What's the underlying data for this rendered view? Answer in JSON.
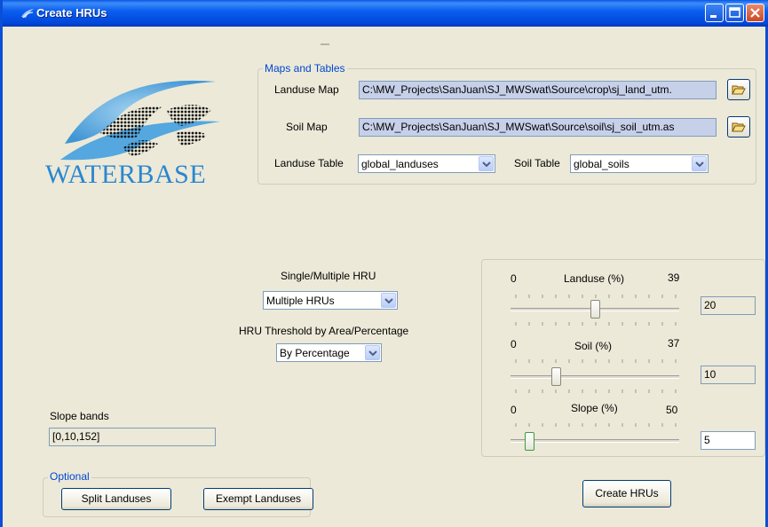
{
  "window": {
    "title": "Create HRUs"
  },
  "logo": {
    "text": "WATERBASE"
  },
  "maps_and_tables": {
    "legend": "Maps and Tables",
    "landuse_map_label": "Landuse Map",
    "landuse_map_path": "C:\\MW_Projects\\SanJuan\\SJ_MWSwat\\Source\\crop\\sj_land_utm.",
    "soil_map_label": "Soil Map",
    "soil_map_path": "C:\\MW_Projects\\SanJuan\\SJ_MWSwat\\Source\\soil\\sj_soil_utm.as",
    "landuse_table_label": "Landuse Table",
    "landuse_table_value": "global_landuses",
    "soil_table_label": "Soil Table",
    "soil_table_value": "global_soils"
  },
  "hru": {
    "single_multiple_label": "Single/Multiple HRU",
    "single_multiple_value": "Multiple HRUs",
    "threshold_label": "HRU Threshold by Area/Percentage",
    "threshold_value": "By Percentage"
  },
  "sliders": {
    "landuse": {
      "label": "Landuse (%)",
      "min": "0",
      "max": "39",
      "value": "20",
      "level": 20
    },
    "soil": {
      "label": "Soil (%)",
      "min": "0",
      "max": "37",
      "value": "10",
      "level": 10
    },
    "slope": {
      "label": "Slope (%)",
      "min": "0",
      "max": "50",
      "value": "5",
      "level": 5
    }
  },
  "slope_bands": {
    "label": "Slope bands",
    "value": "[0,10,152]"
  },
  "optional": {
    "legend": "Optional",
    "split_label": "Split Landuses",
    "exempt_label": "Exempt Landuses"
  },
  "create_button_label": "Create HRUs",
  "colors": {
    "titlebar": "#0a58e8",
    "window_bg": "#ece9d8",
    "legend_text": "#0046d5",
    "path_bg": "#c7d0e9"
  }
}
